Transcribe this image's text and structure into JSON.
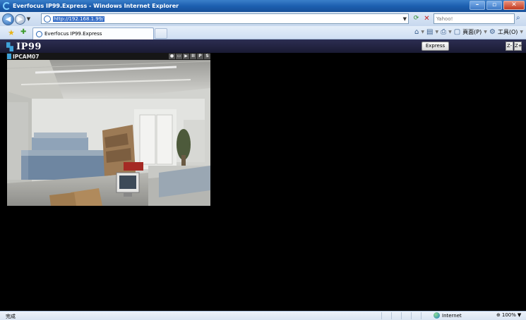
{
  "browser": {
    "title": "Everfocus IP99.Express - Windows Internet Explorer",
    "window_buttons": {
      "minimize": "–",
      "maximize": "▫",
      "close": "✕"
    },
    "address": {
      "url": "http://192.168.1.99/"
    },
    "search": {
      "placeholder": "Yahoo!"
    },
    "tab": {
      "label": "Everfocus IP99.Express"
    },
    "command_bar": {
      "page": "頁面(P)",
      "tools": "工具(O)"
    },
    "status": {
      "text": "完成",
      "zone": "Internet",
      "zoom": "100%"
    }
  },
  "app": {
    "logo": "IP99",
    "express_button": "Express",
    "zoom_out": "Z-",
    "zoom_in": "Z+",
    "camera": {
      "name": "IPCAM07",
      "controls": [
        "●",
        "▭",
        "▶",
        "II",
        "P",
        "S"
      ]
    }
  },
  "colors": {
    "app_background": "#000000",
    "header_background": "#1f2040",
    "logo_accent": "#3fa2d9"
  }
}
